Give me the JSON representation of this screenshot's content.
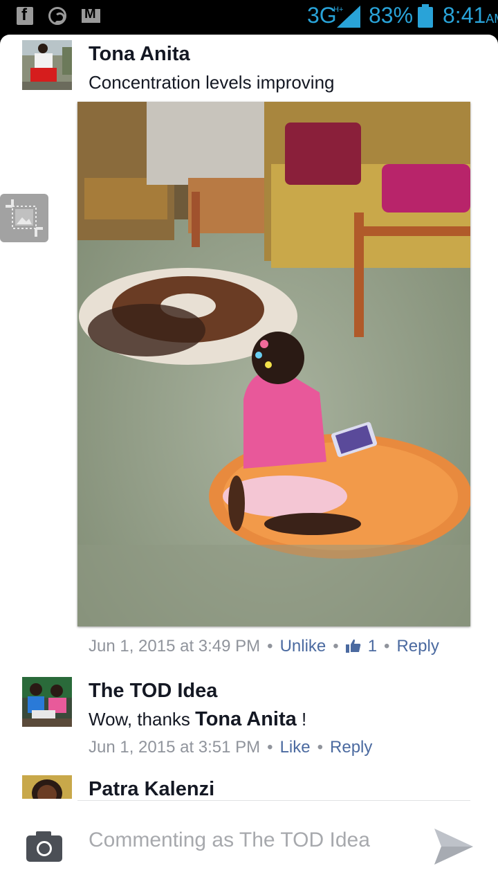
{
  "status_bar": {
    "network": "3G",
    "network_sup": "H+",
    "battery": "83%",
    "time": "8:41",
    "ampm": "AM",
    "icons": [
      "facebook-icon",
      "whatsapp-icon",
      "gmail-icon",
      "signal-icon",
      "battery-icon"
    ]
  },
  "post": {
    "author": "Tona Anita",
    "text": "Concentration levels improving",
    "meta": {
      "time": "Jun 1, 2015 at 3:49 PM",
      "unlike": "Unlike",
      "likes": "1",
      "reply": "Reply"
    }
  },
  "reply1": {
    "author": "The TOD Idea",
    "text_prefix": "Wow, thanks ",
    "mention": "Tona Anita",
    "text_suffix": " !",
    "meta": {
      "time": "Jun 1, 2015 at 3:51 PM",
      "like": "Like",
      "reply": "Reply"
    }
  },
  "reply2": {
    "author": "Patra Kalenzi"
  },
  "composer": {
    "placeholder": "Commenting as The TOD Idea"
  },
  "colors": {
    "accent": "#29a3d8",
    "link": "#4b6aa0",
    "meta": "#90949c"
  }
}
